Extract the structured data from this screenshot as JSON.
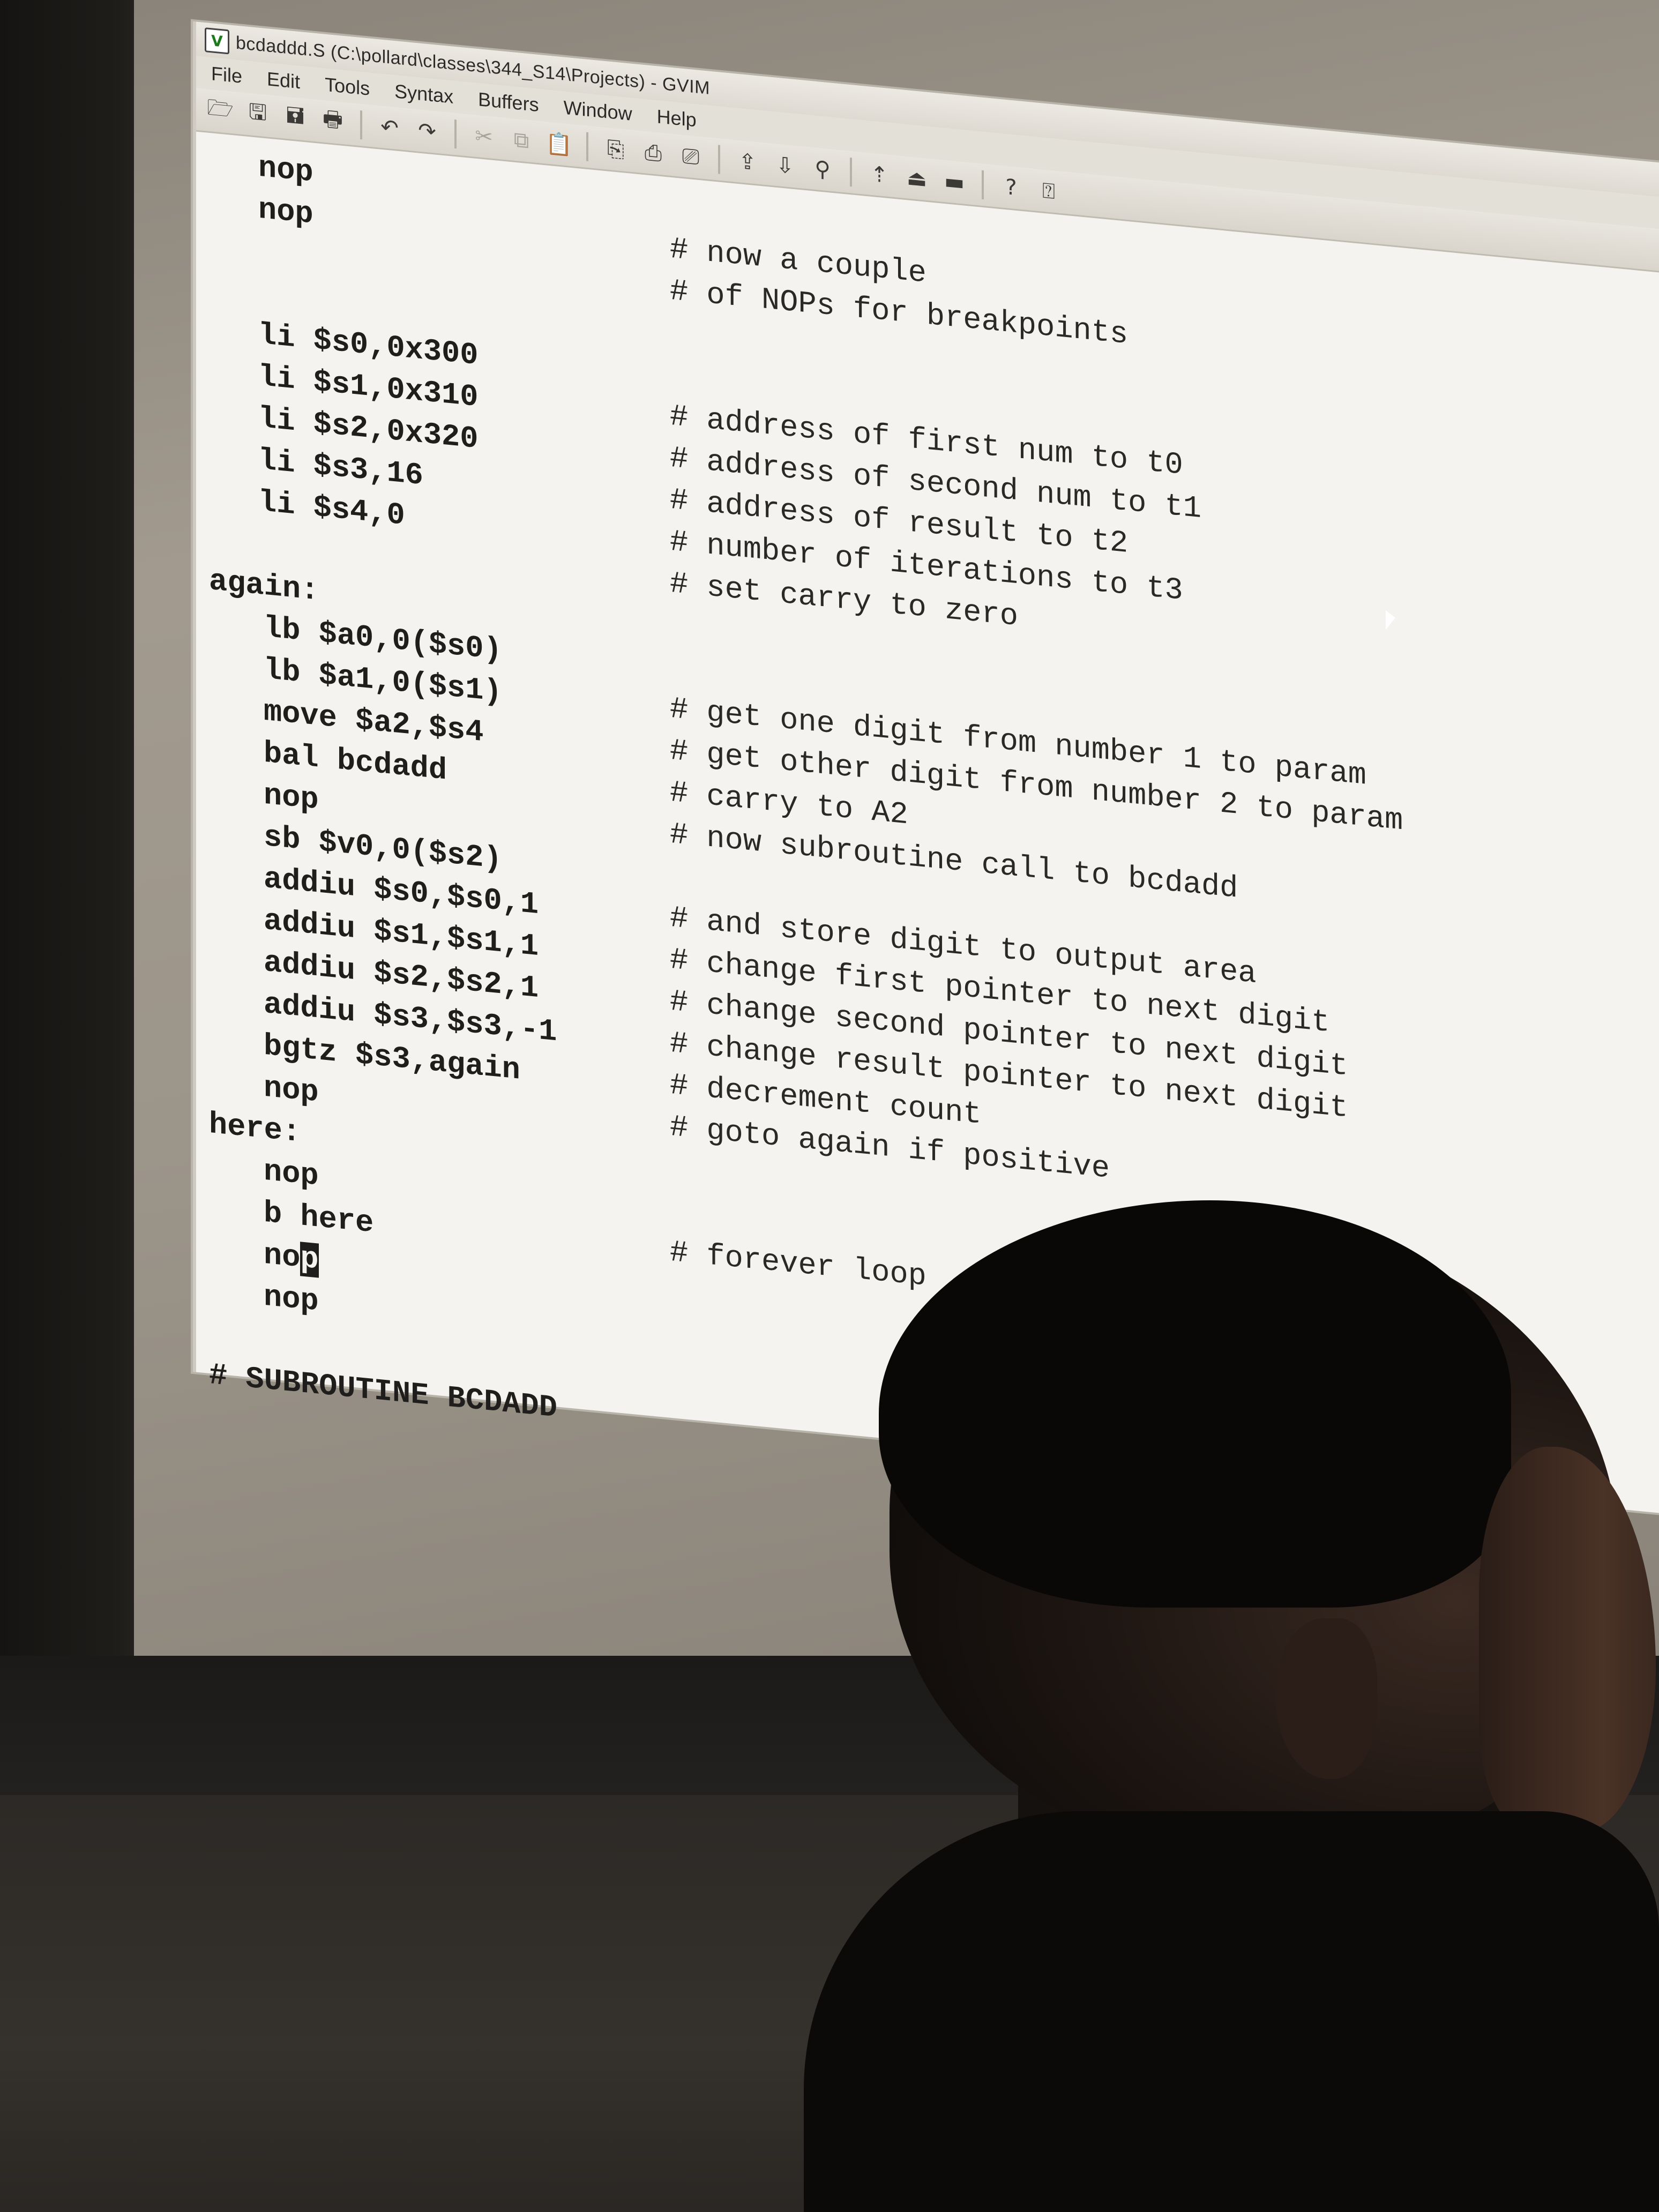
{
  "window": {
    "title": "bcdaddd.S (C:\\pollard\\classes\\344_S14\\Projects) - GVIM",
    "icon": "vim-icon"
  },
  "menu": [
    "File",
    "Edit",
    "Tools",
    "Syntax",
    "Buffers",
    "Window",
    "Help"
  ],
  "toolbar": {
    "icons": [
      "open-icon",
      "save-icon",
      "save-all-icon",
      "print-icon",
      "undo-icon",
      "redo-icon",
      "cut-icon",
      "copy-icon",
      "paste-icon",
      "find-icon",
      "find-next-icon",
      "find-prev-icon",
      "load-session-icon",
      "save-session-icon",
      "run-script-icon",
      "make-icon",
      "shell-icon",
      "tags-icon",
      "help-icon",
      "find-help-icon"
    ],
    "glyphs": [
      "🗁",
      "🖫",
      "🖬",
      "🖶",
      "↶",
      "↷",
      "✂",
      "⧉",
      "📋",
      "⎘",
      "⎙",
      "⎚",
      "⇪",
      "⇩",
      "⚲",
      "⇡",
      "⏏",
      "▬",
      "?",
      "⍰"
    ]
  },
  "code": [
    {
      "text": "nop",
      "comment": "",
      "indent": 1
    },
    {
      "text": "nop",
      "comment": "# now a couple",
      "indent": 1
    },
    {
      "text": "",
      "comment": "# of NOPs for breakpoints",
      "indent": 1
    },
    {
      "text": "",
      "comment": "",
      "indent": 1
    },
    {
      "text": "li $s0,0x300",
      "comment": "",
      "indent": 1
    },
    {
      "text": "li $s1,0x310",
      "comment": "# address of first num to t0",
      "indent": 1
    },
    {
      "text": "li $s2,0x320",
      "comment": "# address of second num to t1",
      "indent": 1
    },
    {
      "text": "li $s3,16",
      "comment": "# address of result to t2",
      "indent": 1
    },
    {
      "text": "li $s4,0",
      "comment": "# number of iterations to t3",
      "indent": 1
    },
    {
      "text": "",
      "comment": "# set carry to zero",
      "indent": 1
    },
    {
      "text": "again:",
      "comment": "",
      "indent": 0
    },
    {
      "text": "lb $a0,0($s0)",
      "comment": "",
      "indent": 2
    },
    {
      "text": "lb $a1,0($s1)",
      "comment": "# get one digit from number 1 to param",
      "indent": 2
    },
    {
      "text": "move $a2,$s4",
      "comment": "# get other digit from number 2 to param",
      "indent": 2
    },
    {
      "text": "bal bcdadd",
      "comment": "# carry to A2",
      "indent": 2
    },
    {
      "text": "nop",
      "comment": "# now subroutine call to bcdadd",
      "indent": 2
    },
    {
      "text": "sb $v0,0($s2)",
      "comment": "",
      "indent": 2
    },
    {
      "text": "addiu $s0,$s0,1",
      "comment": "# and store digit to output area",
      "indent": 2
    },
    {
      "text": "addiu $s1,$s1,1",
      "comment": "# change first pointer to next digit",
      "indent": 2
    },
    {
      "text": "addiu $s2,$s2,1",
      "comment": "# change second pointer to next digit",
      "indent": 2
    },
    {
      "text": "addiu $s3,$s3,-1",
      "comment": "# change result pointer to next digit",
      "indent": 2
    },
    {
      "text": "bgtz $s3,again",
      "comment": "# decrement count",
      "indent": 2
    },
    {
      "text": "nop",
      "comment": "# goto again if positive",
      "indent": 2
    },
    {
      "text": "here:",
      "comment": "",
      "indent": 0
    },
    {
      "text": "nop",
      "comment": "",
      "indent": 2
    },
    {
      "text": "b here",
      "comment": "# forever loop",
      "indent": 2
    },
    {
      "text": "nop",
      "comment": "",
      "indent": 2,
      "cursor_at": 2
    },
    {
      "text": "nop",
      "comment": "",
      "indent": 2
    },
    {
      "text": "",
      "comment": "",
      "indent": 0
    },
    {
      "text": "# SUBROUTINE BCDADD",
      "comment": "",
      "indent": 0
    }
  ]
}
